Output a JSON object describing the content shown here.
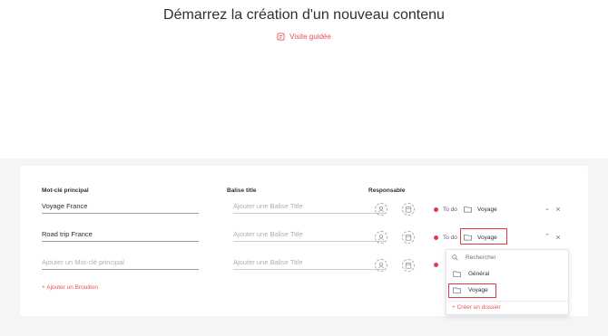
{
  "header": {
    "title": "Démarrez la création d'un nouveau contenu",
    "guided_tour": "Visite guidée"
  },
  "table": {
    "columns": {
      "keyword": "Mot-clé principal",
      "title": "Balise title",
      "owner": "Responsable"
    },
    "rows": [
      {
        "keyword": "Voyage France",
        "keyword_placeholder": "",
        "title_placeholder": "Ajouter une Balise Title",
        "status": "To do",
        "folder": "Voyage"
      },
      {
        "keyword": "Road trip France",
        "keyword_placeholder": "",
        "title_placeholder": "Ajouter une Balise Title",
        "status": "To do",
        "folder": "Voyage"
      },
      {
        "keyword": "",
        "keyword_placeholder": "Ajouter un Mot-clé principal",
        "title_placeholder": "Ajouter une Balise Title",
        "status": "",
        "folder": ""
      }
    ],
    "add_draft": "+ Ajouter un Brouillon"
  },
  "dropdown": {
    "search_placeholder": "Rechercher",
    "items": [
      "Général",
      "Voyage"
    ],
    "selected": "Voyage",
    "create": "+ Créer un dossier"
  },
  "colors": {
    "accent": "#e8505b",
    "status_dot": "#e63946",
    "highlight": "#e63946"
  }
}
